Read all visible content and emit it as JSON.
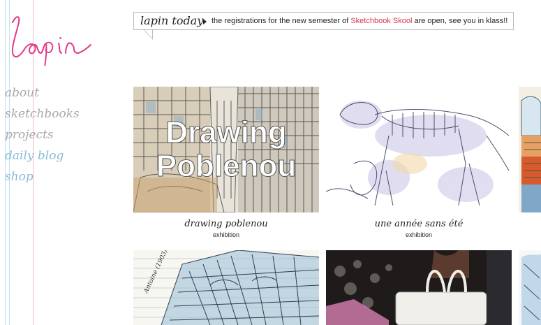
{
  "logo": {
    "text": "lapin",
    "color": "#e23a86"
  },
  "nav": {
    "items": [
      {
        "label": "about"
      },
      {
        "label": "sketchbooks"
      },
      {
        "label": "projects"
      },
      {
        "label": "daily blog"
      },
      {
        "label": "shop"
      }
    ]
  },
  "ticker": {
    "title": "lapin today",
    "text_before": "the registrations for the new semester of ",
    "link": "Sketchbook Skool",
    "text_after": " are open, see you in klass!!",
    "link_color": "#d9344f"
  },
  "tiles": [
    {
      "overlay_line1": "Drawing",
      "overlay_line2": "Poblenou",
      "title": "drawing poblenou",
      "type": "exhibition"
    },
    {
      "title": "une année sans été",
      "type": "exhibition"
    }
  ],
  "colors": {
    "guide_blue": "#bfe3ee",
    "guide_pink": "#f4b8cf",
    "nav_grey": "#a9a9a9",
    "nav_blue": "#88bcd3"
  }
}
